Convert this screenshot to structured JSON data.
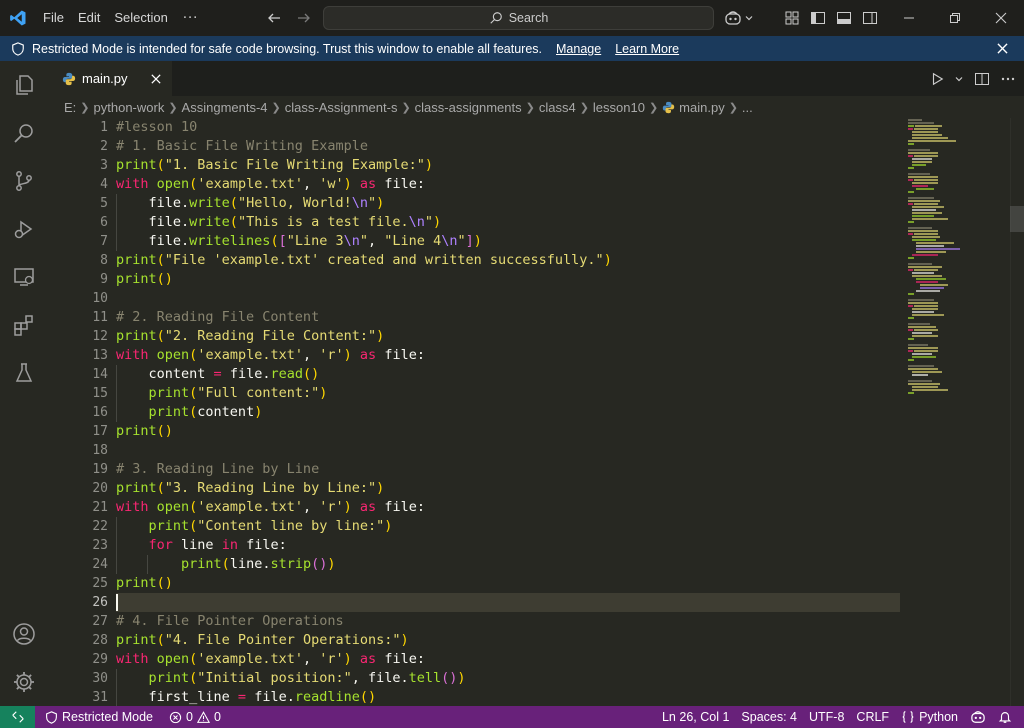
{
  "titlebar": {
    "menu": [
      "File",
      "Edit",
      "Selection"
    ],
    "more": "···",
    "search_placeholder": "Search"
  },
  "banner": {
    "text": "Restricted Mode is intended for safe code browsing. Trust this window to enable all features.",
    "manage": "Manage",
    "learn_more": "Learn More"
  },
  "tab": {
    "label": "main.py"
  },
  "breadcrumb": [
    "E:",
    "python-work",
    "Assingments-4",
    "class-Assignment-s",
    "class-assignments",
    "class4",
    "lesson10",
    "main.py",
    "..."
  ],
  "editor": {
    "line_numbers": [
      "1",
      "2",
      "3",
      "4",
      "5",
      "6",
      "7",
      "8",
      "9",
      "10",
      "11",
      "12",
      "13",
      "14",
      "15",
      "16",
      "17",
      "18",
      "19",
      "20",
      "21",
      "22",
      "23",
      "24",
      "25",
      "26",
      "27",
      "28",
      "29",
      "30",
      "31"
    ],
    "active_line": "26"
  },
  "statusbar": {
    "restricted": "Restricted Mode",
    "errors": "0",
    "warnings": "0",
    "position": "Ln 26, Col 1",
    "spaces": "Spaces: 4",
    "encoding": "UTF-8",
    "eol": "CRLF",
    "language": "Python"
  },
  "colors": {
    "editor_bg": "#272822",
    "banner_bg": "#1b3a5c",
    "statusbar_bg": "#68217a",
    "keyword": "#f92672",
    "function": "#a6e22e",
    "string": "#e6db74",
    "comment": "#88846f"
  }
}
